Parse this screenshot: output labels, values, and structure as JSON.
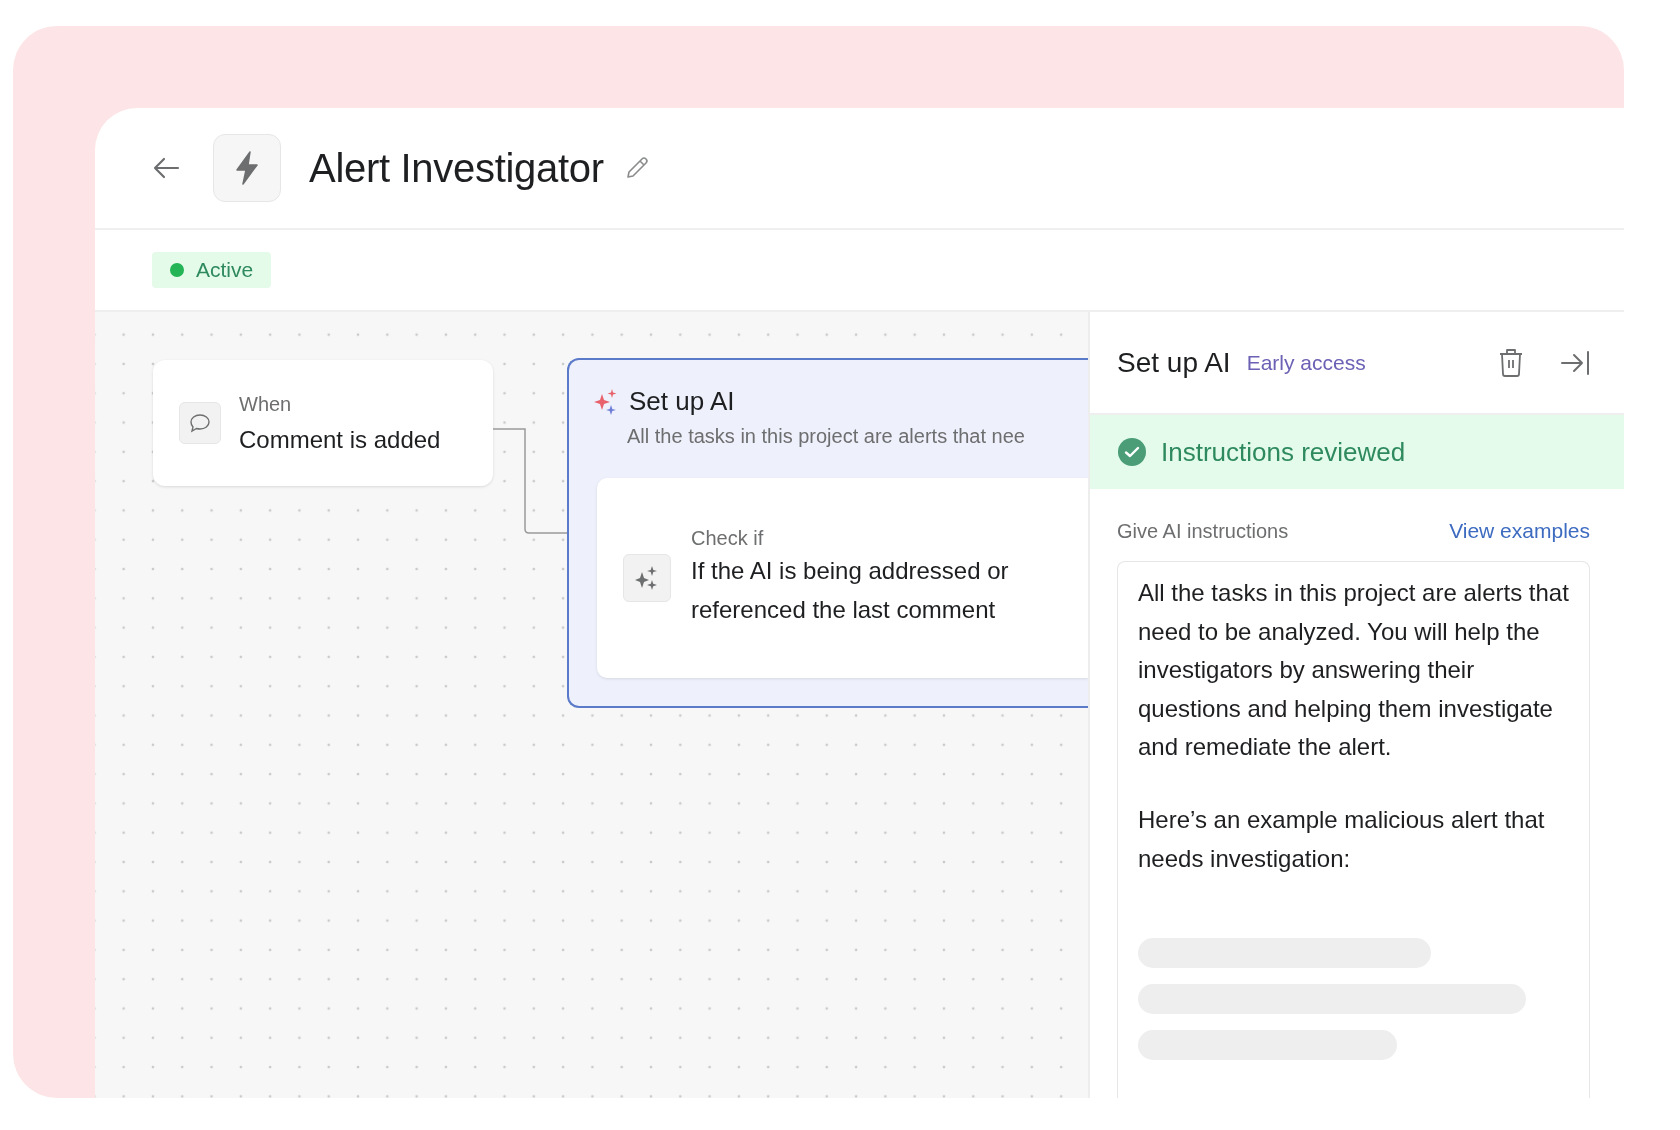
{
  "header": {
    "title": "Alert Investigator"
  },
  "status": {
    "label": "Active"
  },
  "canvas": {
    "trigger": {
      "label": "When",
      "value": "Comment is added"
    },
    "ai_step": {
      "title": "Set up AI",
      "description": "All the tasks in this project are alerts that nee",
      "condition": {
        "label": "Check if",
        "text": "If the AI is being addressed or referenced the last comment"
      }
    }
  },
  "panel": {
    "title": "Set up AI",
    "badge": "Early access",
    "banner": "Instructions reviewed",
    "field_label": "Give AI instructions",
    "link": "View examples",
    "instructions": [
      "All the tasks in this project are alerts that need to be analyzed. You will help the investigators by answering their questions and helping them investigate and remediate the alert.",
      "Here’s an example malicious alert that needs investigation:"
    ]
  }
}
